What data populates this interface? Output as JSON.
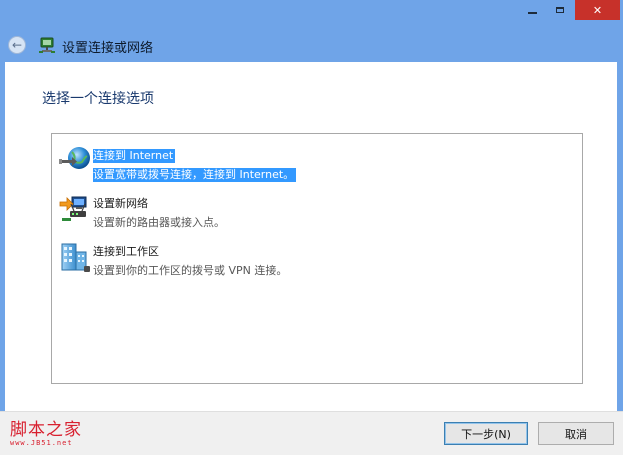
{
  "window": {
    "title": "设置连接或网络",
    "close_label": "✕"
  },
  "main": {
    "heading": "选择一个连接选项",
    "options": [
      {
        "title": "连接到 Internet",
        "description": "设置宽带或拨号连接，连接到 Internet。",
        "icon": "globe-network-icon",
        "selected": true
      },
      {
        "title": "设置新网络",
        "description": "设置新的路由器或接入点。",
        "icon": "new-network-icon",
        "selected": false
      },
      {
        "title": "连接到工作区",
        "description": "设置到你的工作区的拨号或 VPN 连接。",
        "icon": "workplace-icon",
        "selected": false
      }
    ]
  },
  "footer": {
    "next_label": "下一步(N)",
    "cancel_label": "取消"
  },
  "watermark": {
    "text": "脚本之家",
    "url": "www.JB51.net"
  },
  "colors": {
    "titlebar": "#6fa4e8",
    "close": "#c7312a",
    "selection": "#3399ff",
    "heading": "#1a3a6e",
    "watermark": "#d8202f"
  }
}
